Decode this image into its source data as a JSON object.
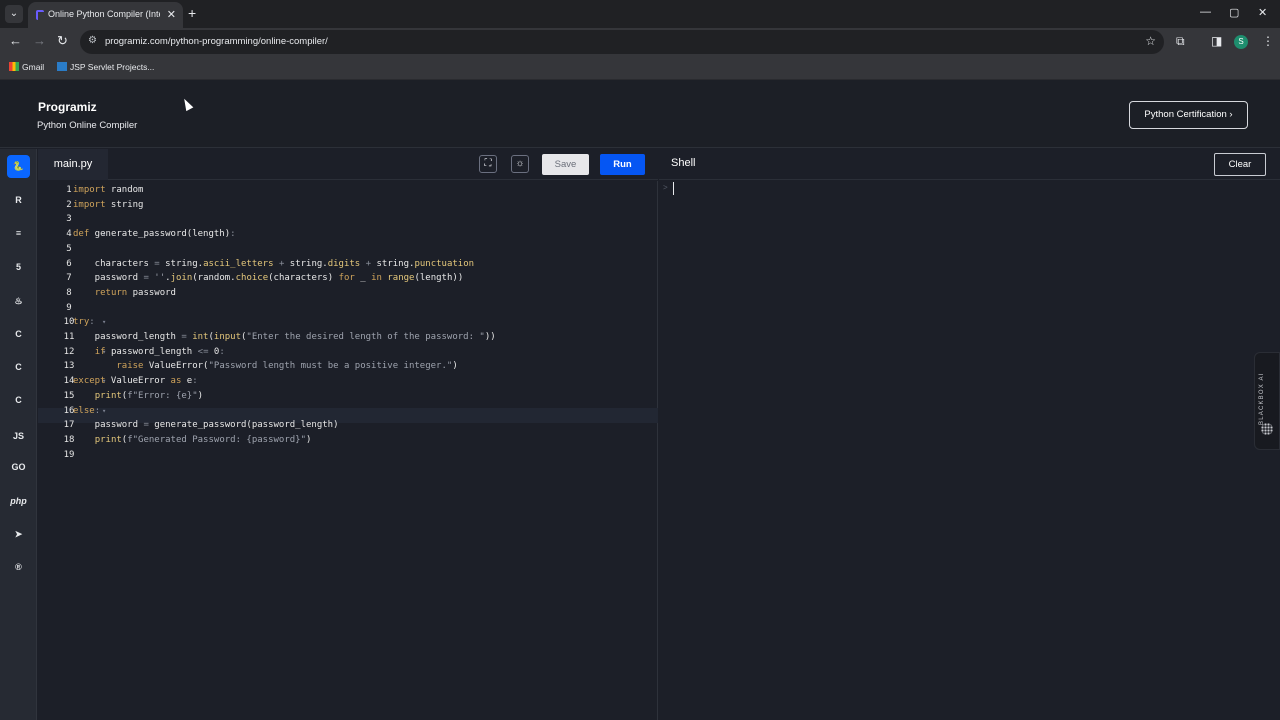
{
  "browser": {
    "tab_title": "Online Python Compiler (Interpreter)",
    "url": "programiz.com/python-programming/online-compiler/",
    "profile_initial": "S",
    "bookmarks": [
      "Gmail",
      "JSP Servlet Projects..."
    ]
  },
  "site": {
    "logo": "Programiz",
    "subtitle": "Python Online Compiler",
    "cert_button": "Python Certification ›"
  },
  "languages": [
    {
      "name": "python-lang",
      "glyph": "🐍",
      "active": true
    },
    {
      "name": "r-lang",
      "glyph": "R"
    },
    {
      "name": "sql-lang",
      "glyph": "≡"
    },
    {
      "name": "html-lang",
      "glyph": "5"
    },
    {
      "name": "java-lang",
      "glyph": "♨"
    },
    {
      "name": "c-lang",
      "glyph": "C"
    },
    {
      "name": "cpp-lang",
      "glyph": "C"
    },
    {
      "name": "csharp-lang",
      "glyph": "C"
    },
    {
      "name": "js-lang",
      "glyph": "JS"
    },
    {
      "name": "go-lang",
      "glyph": "GO"
    },
    {
      "name": "php-lang",
      "glyph": "php"
    },
    {
      "name": "swift-lang",
      "glyph": "➤"
    },
    {
      "name": "rust-lang",
      "glyph": "®"
    }
  ],
  "editor": {
    "file_tab": "main.py",
    "save_label": "Save",
    "run_label": "Run",
    "lines": [
      "import random",
      "import string",
      "",
      "def generate_password(length):",
      "",
      "    characters = string.ascii_letters + string.digits + string.punctuation",
      "    password = ''.join(random.choice(characters) for _ in range(length))",
      "    return password",
      "",
      "try:",
      "    password_length = int(input(\"Enter the desired length of the password: \"))",
      "    if password_length <= 0:",
      "        raise ValueError(\"Password length must be a positive integer.\")",
      "except ValueError as e:",
      "    print(f\"Error: {e}\")",
      "else:",
      "    password = generate_password(password_length)",
      "    print(f\"Generated Password: {password}\")",
      ""
    ]
  },
  "shell": {
    "title": "Shell",
    "clear_label": "Clear",
    "prompt": ">"
  },
  "blackbox_label": "BLACKBOX AI"
}
